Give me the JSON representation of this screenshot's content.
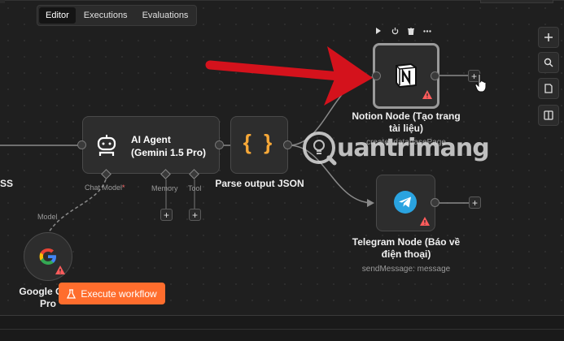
{
  "tabs": [
    {
      "label": "Editor",
      "active": true
    },
    {
      "label": "Executions",
      "active": false
    },
    {
      "label": "Evaluations",
      "active": false
    }
  ],
  "toolbar_icons": [
    "plus-icon",
    "zoom-icon",
    "sticky-note-icon",
    "panel-icon"
  ],
  "node_actions": [
    "play-icon",
    "power-icon",
    "trash-icon",
    "more-icon"
  ],
  "nodes": {
    "left_cut": {
      "label": "SS"
    },
    "ai_agent": {
      "title_line1": "AI Agent",
      "title_line2": "(Gemini 1.5 Pro)",
      "sub_chat": "Chat Model",
      "sub_chat_req": "*",
      "sub_memory": "Memory",
      "sub_tool": "Tool"
    },
    "parse_json": {
      "label": "Parse output JSON",
      "icon": "{ }"
    },
    "notion": {
      "label_line1": "Notion Node (Tạo trang",
      "label_line2": "tài liệu)",
      "operation": "create: databasePage"
    },
    "telegram": {
      "label_line1": "Telegram Node (Báo về",
      "label_line2": "điện thoại)",
      "operation": "sendMessage: message"
    },
    "gemini": {
      "label_line1": "Google Gem",
      "label_line2": "Pro",
      "model_label": "Model"
    }
  },
  "watermark": "uantrimang",
  "execute_button": {
    "label": "Execute workflow"
  },
  "colors": {
    "accent": "#ff6d2d",
    "arrow": "#d4121c",
    "warning": "#ff5c5c",
    "telegram": "#2aa3e0"
  }
}
